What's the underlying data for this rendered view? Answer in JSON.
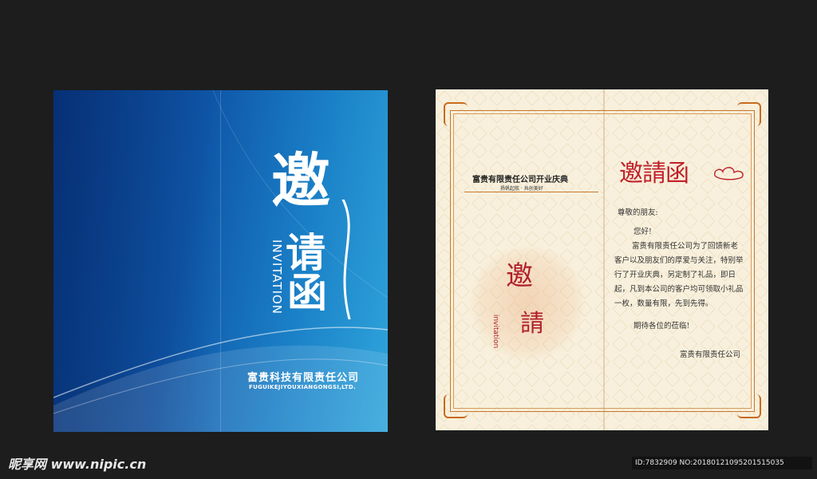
{
  "cover": {
    "title_char_1": "邀",
    "title_char_2": "请",
    "title_char_3": "函",
    "vertical_en": "INVITATION",
    "company_cn": "富贵科技有限责任公司",
    "company_en": "FUGUIKEJIYOUXIANGONGSI,LTD."
  },
  "inner": {
    "event_title": "富贵有限责任公司开业庆典",
    "event_subtitle": "扬帆起航 · 共创美好",
    "red_title": "邀請函",
    "seal_char_1": "邀",
    "seal_char_2": "請",
    "seal_en": "invitation",
    "greeting": "尊敬的朋友:",
    "hello": "您好!",
    "paragraph": "富贵有限责任公司为了回馈新老客户以及朋友们的厚爱与关注，特别举行了开业庆典，另定制了礼品，即日起，凡到本公司的客户均可领取小礼品一枚，数量有限，先到先得。",
    "look_forward": "期待各位的莅临!",
    "signature": "富贵有限责任公司"
  },
  "watermark": {
    "site": "昵享网 www.nipic.cn",
    "id_text": "ID:7832909 NO:20180121095201515035"
  },
  "colors": {
    "background": "#1d1d1e",
    "cover_blue": "#0f56a8",
    "card_cream": "#f8f0dc",
    "accent_red": "#c0202a",
    "frame_orange": "#c8762a"
  }
}
